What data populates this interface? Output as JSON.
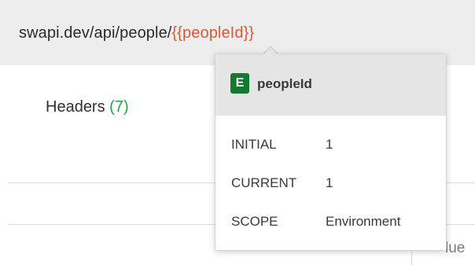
{
  "request": {
    "url_base": "swapi.dev/api/people/",
    "url_variable": "{{peopleId}}"
  },
  "tabs": {
    "headers_label": "Headers",
    "headers_count": "(7)"
  },
  "table": {
    "value_header_fragment": "lue"
  },
  "variable_tooltip": {
    "scope_badge": "E",
    "variable_name": "peopleId",
    "rows": [
      {
        "key": "INITIAL",
        "value": "1"
      },
      {
        "key": "CURRENT",
        "value": "1"
      },
      {
        "key": "SCOPE",
        "value": "Environment"
      }
    ]
  },
  "colors": {
    "variable_text": "#e4572e",
    "environment_badge": "#127a2e",
    "count_text": "#25a244",
    "url_bar_bg": "#ededed"
  }
}
